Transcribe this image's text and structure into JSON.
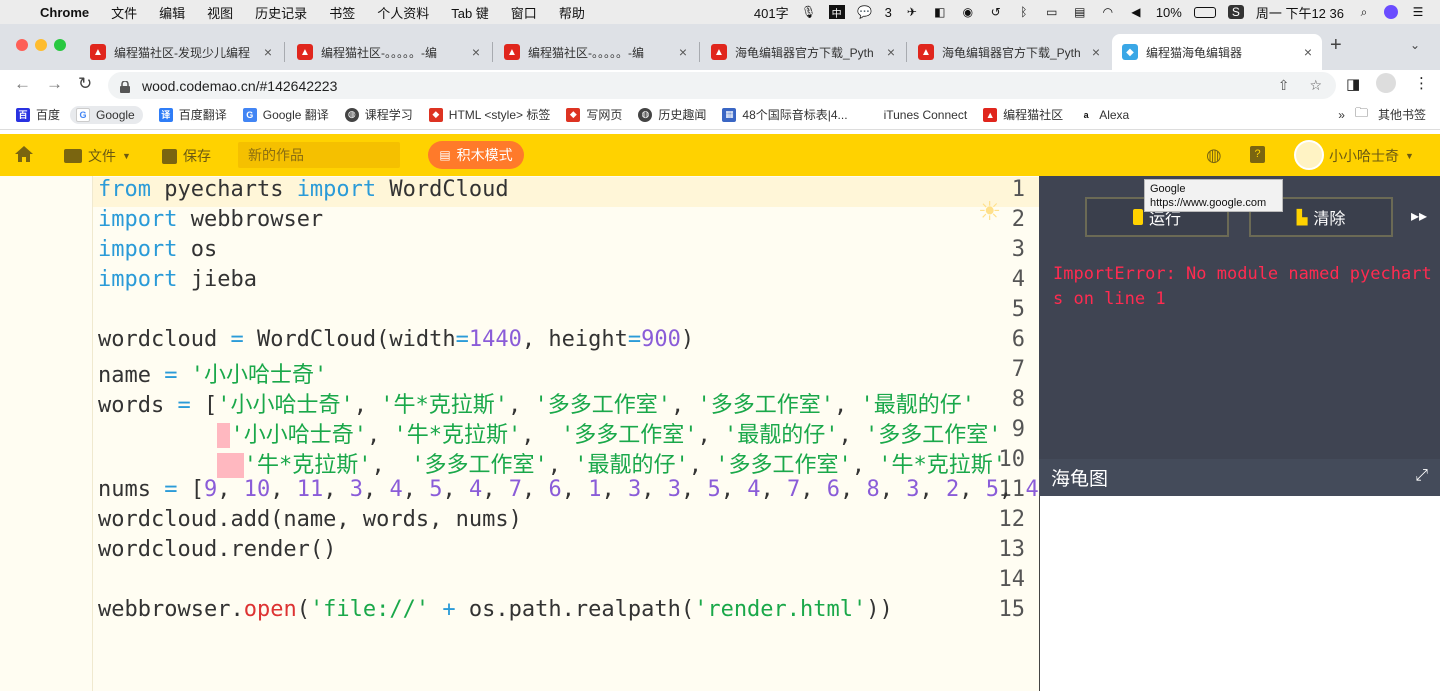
{
  "menubar": {
    "app": "Chrome",
    "menus": [
      "文件",
      "编辑",
      "视图",
      "历史记录",
      "书签",
      "个人资料",
      "Tab 键",
      "窗口",
      "帮助"
    ],
    "word_count": "401字",
    "wechat_count": "3",
    "battery": "10%",
    "datetime": "周一 下午12 36"
  },
  "tabs": [
    {
      "title": "编程猫社区-发现少儿编程"
    },
    {
      "title": "编程猫社区-。。。。。-编"
    },
    {
      "title": "编程猫社区-。。。。。-编"
    },
    {
      "title": "海龟编辑器官方下载_Pyth"
    },
    {
      "title": "海龟编辑器官方下载_Pyth"
    },
    {
      "title": "编程猫海龟编辑器",
      "active": true
    }
  ],
  "address": {
    "url": "wood.codemao.cn/#142642223"
  },
  "bookmarks": [
    "百度",
    "Google",
    "百度翻译",
    "Google 翻译",
    "课程学习",
    "HTML <style> 标签",
    "写网页",
    "历史趣闻",
    "48个国际音标表|4...",
    "iTunes Connect",
    "编程猫社区",
    "Alexa"
  ],
  "other_bookmarks": "其他书签",
  "more": "»",
  "tooltip": {
    "line1": "Google",
    "line2": "https://www.google.com"
  },
  "toolbar": {
    "file": "文件",
    "save": "保存",
    "project_name": "新的作品",
    "block_mode": "积木模式",
    "user": "小小哈士奇"
  },
  "editor": {
    "line_numbers": [
      "1",
      "2",
      "3",
      "4",
      "5",
      "6",
      "7",
      "8",
      "9",
      "10",
      "11",
      "12",
      "13",
      "14",
      "15"
    ]
  },
  "console": {
    "run": "运行",
    "clear": "清除",
    "error": "ImportError: No module named pyecharts on line 1"
  },
  "turtle_title": "海龟图"
}
